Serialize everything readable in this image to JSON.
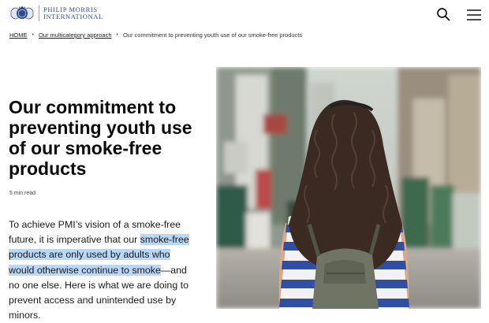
{
  "header": {
    "logo_line1": "PHILIP MORRIS",
    "logo_line2": "INTERNATIONAL",
    "search_icon": "search-icon",
    "menu_icon": "hamburger-menu-icon"
  },
  "breadcrumb": {
    "home": "HOME",
    "parent": "Our multicategory approach",
    "current": "Our commitment to preventing youth use of our smoke-free products"
  },
  "article": {
    "title": "Our commitment to preventing youth use of our smoke-free products",
    "read_time": "5 min read",
    "lede_part1": "To achieve PMI’s vision of a smoke-free future, it is imperative that our ",
    "lede_highlight": "smoke-free products are only used by adults who would otherwise continue to smoke",
    "lede_part2": "—and no one else. Here is what we are doing to prevent access and unintended use by minors."
  },
  "colors": {
    "brand": "#2f4a8a",
    "highlight": "#b9d7f7"
  }
}
